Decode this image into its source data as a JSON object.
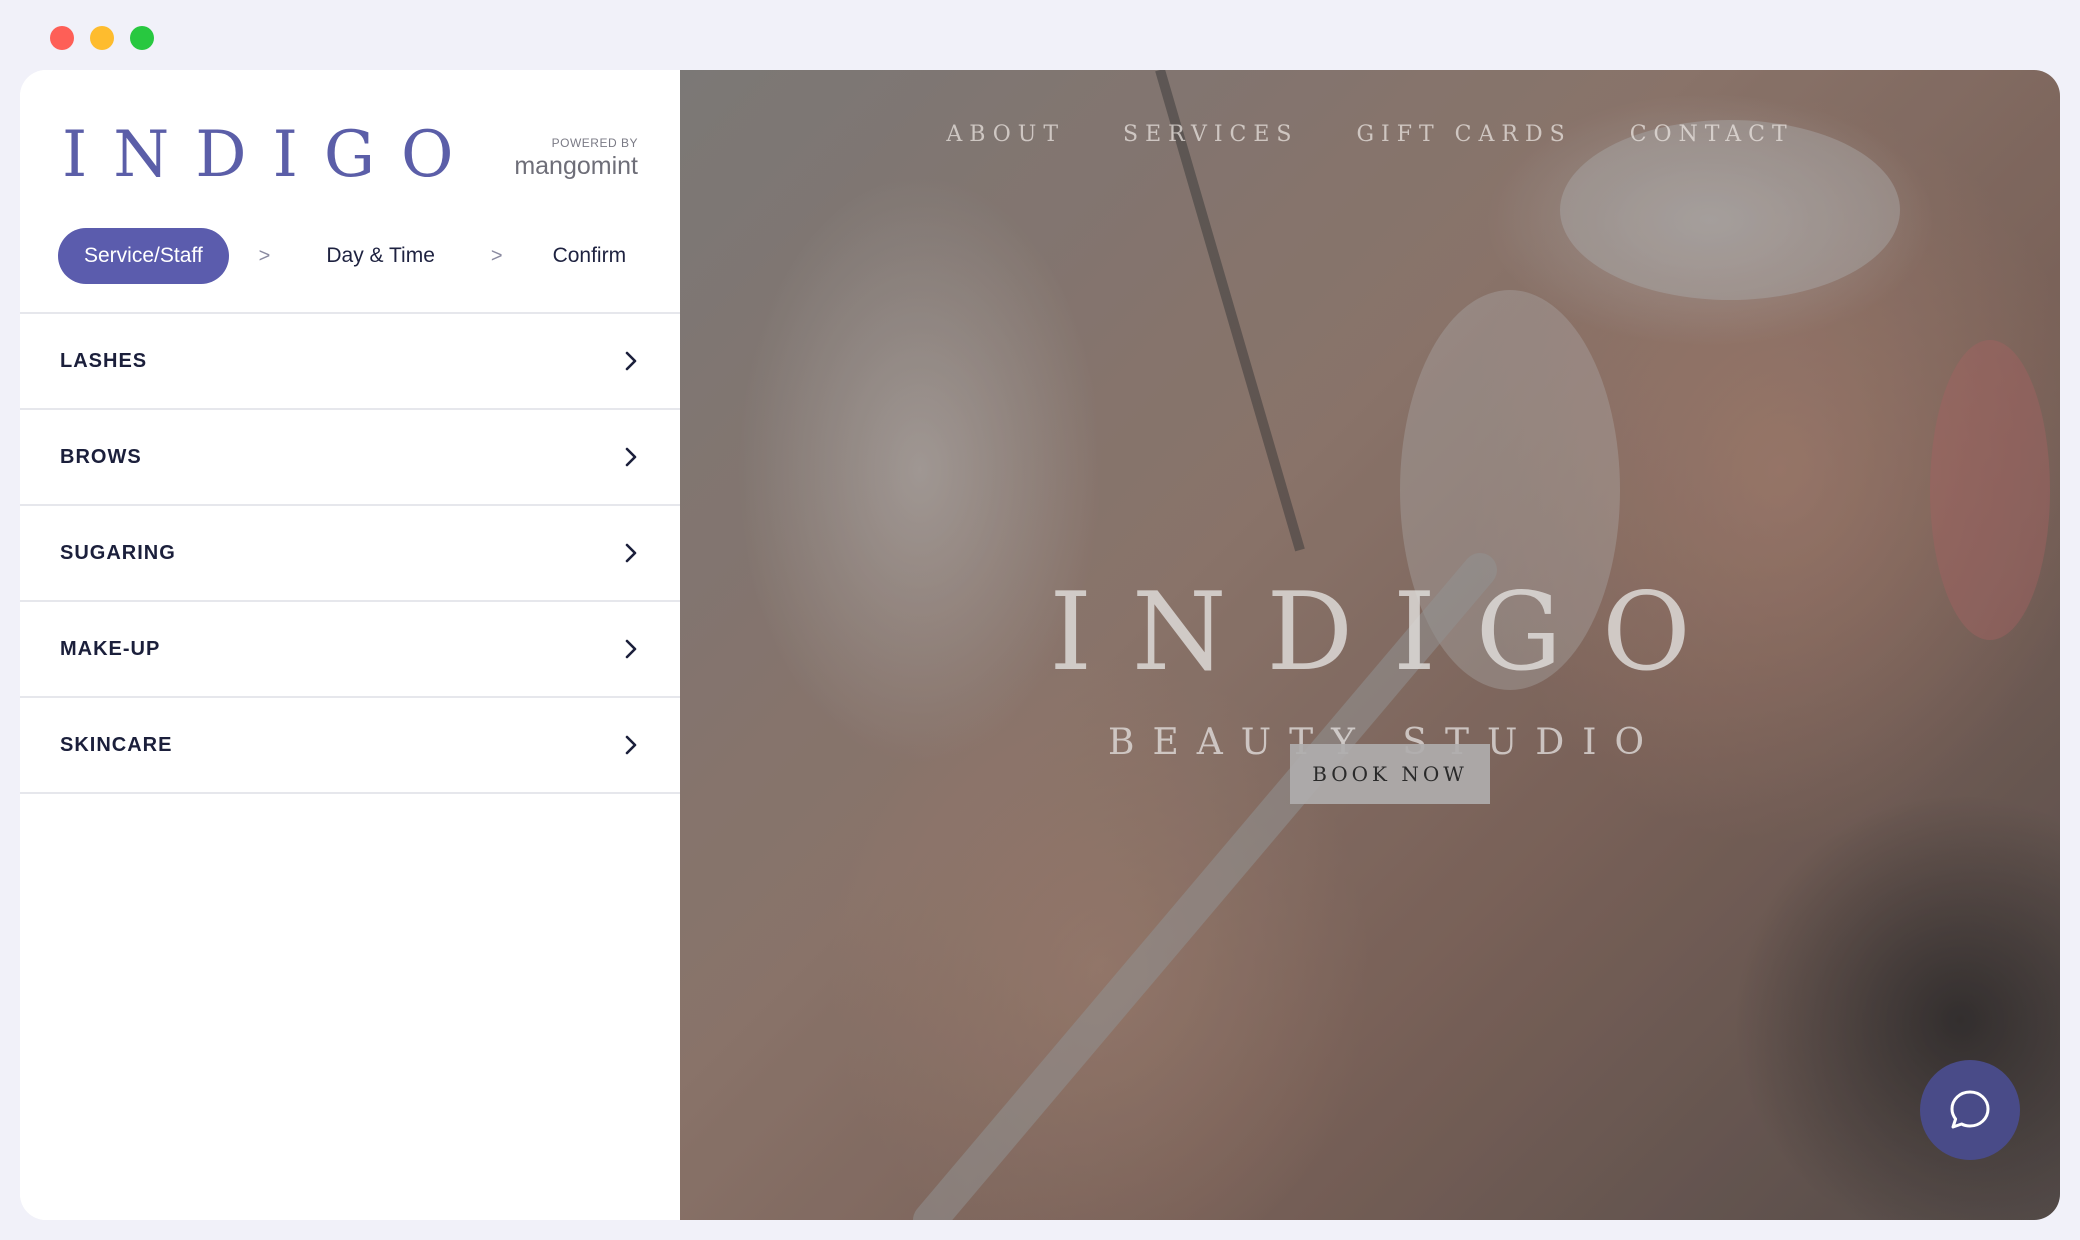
{
  "window": {
    "controls": [
      "close",
      "minimize",
      "maximize"
    ],
    "colors": {
      "close": "#fe5f57",
      "minimize": "#febc2e",
      "maximize": "#28c840"
    }
  },
  "sidebar": {
    "brand": "INDIGO",
    "powered_by_label": "POWERED BY",
    "powered_by_name": "mangomint",
    "steps": {
      "active": "Service/Staff",
      "separator": ">",
      "day_time": "Day & Time",
      "confirm": "Confirm"
    },
    "categories": [
      {
        "label": "LASHES",
        "icon": "chevron-right-icon"
      },
      {
        "label": "BROWS",
        "icon": "chevron-right-icon"
      },
      {
        "label": "SUGARING",
        "icon": "chevron-right-icon"
      },
      {
        "label": "MAKE-UP",
        "icon": "chevron-right-icon"
      },
      {
        "label": "SKINCARE",
        "icon": "chevron-right-icon"
      }
    ]
  },
  "hero": {
    "nav": [
      "ABOUT",
      "SERVICES",
      "GIFT CARDS",
      "CONTACT"
    ],
    "title": "INDIGO",
    "subtitle": "BEAUTY STUDIO",
    "cta": "BOOK NOW",
    "chat_icon": "chat-bubble-icon"
  },
  "colors": {
    "accent": "#5b5cad",
    "chat_button": "#494b88",
    "category_text": "#1b1f3b"
  }
}
